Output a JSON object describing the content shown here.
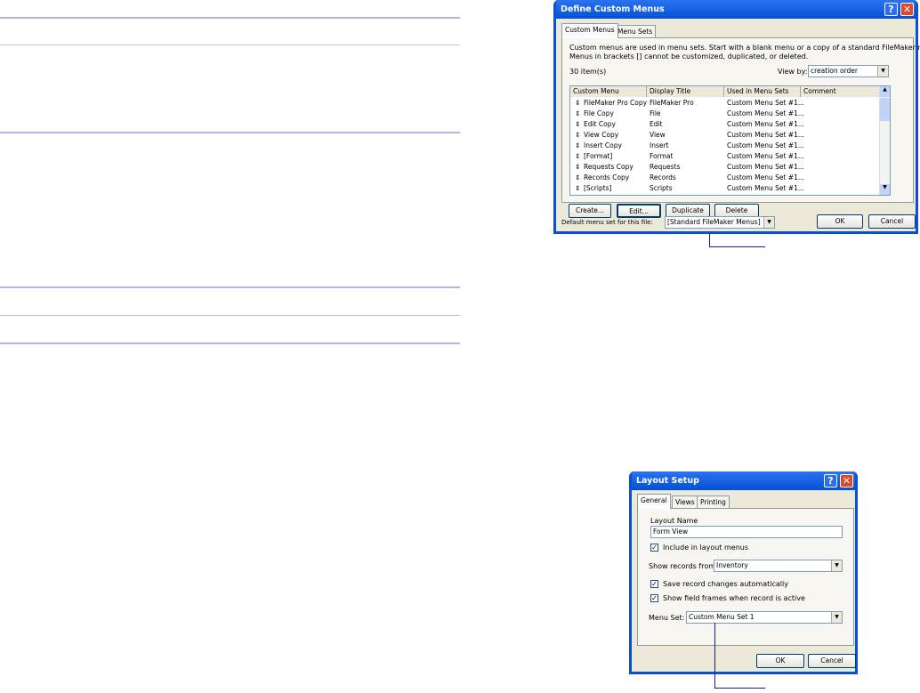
{
  "custom_menus_dialog": {
    "title": "Define Custom Menus",
    "tabs": [
      "Custom Menus",
      "Menu Sets"
    ],
    "description_1": "Custom menus are used in menu sets. Start with a blank menu or a copy of a standard FileMaker menu.",
    "description_2": "Menus in brackets [] cannot be customized, duplicated, or deleted.",
    "item_count": "30 item(s)",
    "view_by_label": "View by:",
    "view_by_value": "creation order",
    "columns": [
      "Custom Menu",
      "Display Title",
      "Used in Menu Sets",
      "Comment"
    ],
    "rows": [
      {
        "menu": "FileMaker Pro Copy",
        "title": "FileMaker Pro",
        "sets": "Custom Menu Set #1..."
      },
      {
        "menu": "File Copy",
        "title": "File",
        "sets": "Custom Menu Set #1..."
      },
      {
        "menu": "Edit Copy",
        "title": "Edit",
        "sets": "Custom Menu Set #1..."
      },
      {
        "menu": "View Copy",
        "title": "View",
        "sets": "Custom Menu Set #1..."
      },
      {
        "menu": "Insert Copy",
        "title": "Insert",
        "sets": "Custom Menu Set #1..."
      },
      {
        "menu": "[Format]",
        "title": "Format",
        "sets": "Custom Menu Set #1..."
      },
      {
        "menu": "Requests Copy",
        "title": "Requests",
        "sets": "Custom Menu Set #1..."
      },
      {
        "menu": "Records Copy",
        "title": "Records",
        "sets": "Custom Menu Set #1..."
      },
      {
        "menu": "[Scripts]",
        "title": "Scripts",
        "sets": "Custom Menu Set #1..."
      }
    ],
    "buttons": {
      "create": "Create...",
      "edit": "Edit...",
      "duplicate": "Duplicate",
      "delete": "Delete",
      "ok": "OK",
      "cancel": "Cancel"
    },
    "default_label": "Default menu set for this file:",
    "default_value": "[Standard FileMaker Menus]",
    "help": "?",
    "close": "✕"
  },
  "layout_dialog": {
    "title": "Layout Setup",
    "tabs": [
      "General",
      "Views",
      "Printing"
    ],
    "layout_name_label": "Layout Name",
    "layout_name_value": "Form View",
    "include_label": "Include in layout menus",
    "show_records_label": "Show records from:",
    "show_records_value": "Inventory",
    "save_label": "Save record changes automatically",
    "frames_label": "Show field frames when record is active",
    "menu_set_label": "Menu Set:",
    "menu_set_value": "Custom Menu Set 1",
    "ok": "OK",
    "cancel": "Cancel",
    "help": "?",
    "close": "✕",
    "check": "✓"
  }
}
